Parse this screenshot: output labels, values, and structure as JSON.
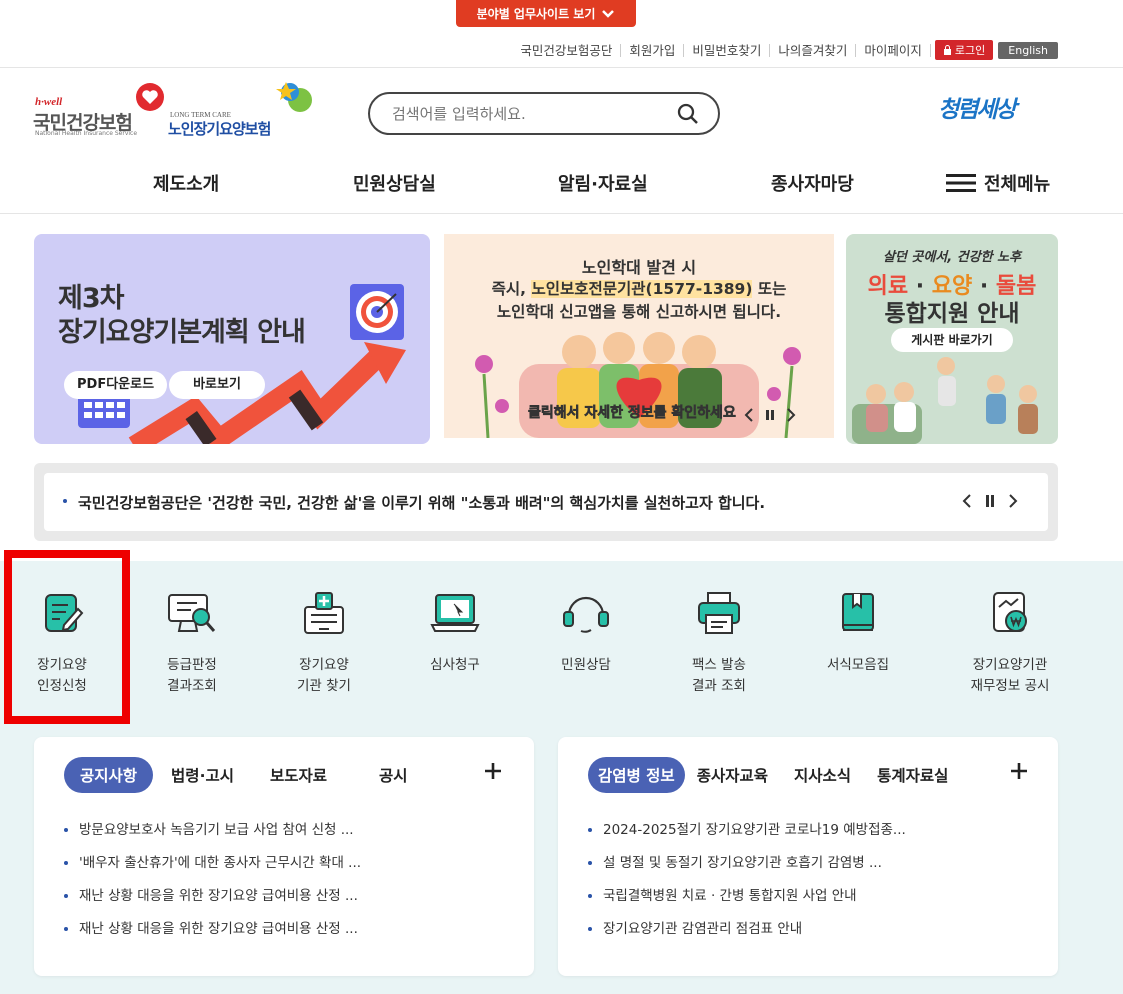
{
  "top_button": "분야별 업무사이트 보기",
  "util_links": [
    "국민건강보험공단",
    "회원가입",
    "비밀번호찾기",
    "나의즐겨찾기",
    "마이페이지"
  ],
  "login_label": "로그인",
  "english_label": "English",
  "logo_nhis": {
    "top": "h·well",
    "main": "국민건강보험",
    "sub": "National Health Insurance Service"
  },
  "logo_ltc": {
    "top": "LONG TERM CARE",
    "main": "노인장기요양보험"
  },
  "search": {
    "placeholder": "검색어를 입력하세요."
  },
  "clean_logo": "청렴세상",
  "gnb": [
    "제도소개",
    "민원상담실",
    "알림·자료실",
    "종사자마당"
  ],
  "all_menu": "전체메뉴",
  "banner1": {
    "line1": "제3차",
    "line2": "장기요양기본계획 안내",
    "btn1": "PDF다운로드",
    "btn2": "바로보기"
  },
  "banner2": {
    "line1": "노인학대 발견 시",
    "line2a": "즉시, ",
    "line2b": "노인보호전문기관(1577-1389)",
    "line2c": " 또는",
    "line3": "노인학대 신고앱을 통해 신고하시면 됩니다.",
    "caption": "클릭해서 자세한 정보를 확인하세요"
  },
  "banner3": {
    "script": "살던 곳에서, 건강한 노후",
    "line1a": "의료",
    "line1b": "요양",
    "line1c": "돌봄",
    "line2": "통합지원 안내",
    "btn": "게시판 바로가기"
  },
  "notice_text": "국민건강보험공단은 '건강한 국민, 건강한 삶'을 이루기 위해 \"소통과 배려\"의 핵심가치를 실천하고자 합니다.",
  "quick_menu": [
    {
      "l1": "장기요양",
      "l2": "인정신청"
    },
    {
      "l1": "등급판정",
      "l2": "결과조회"
    },
    {
      "l1": "장기요양",
      "l2": "기관 찾기"
    },
    {
      "l1": "심사청구",
      "l2": ""
    },
    {
      "l1": "민원상담",
      "l2": ""
    },
    {
      "l1": "팩스 발송",
      "l2": "결과 조회"
    },
    {
      "l1": "서식모음집",
      "l2": ""
    },
    {
      "l1": "장기요양기관",
      "l2": "재무정보 공시"
    }
  ],
  "board1": {
    "tabs": [
      "공지사항",
      "법령·고시",
      "보도자료",
      "공시"
    ],
    "items": [
      "방문요양보호사 녹음기기 보급 사업 참여 신청 ...",
      "'배우자 출산휴가'에 대한 종사자 근무시간 확대 ...",
      "재난 상황 대응을 위한 장기요양 급여비용 산정 ...",
      "재난 상황 대응을 위한 장기요양 급여비용 산정 ..."
    ]
  },
  "board2": {
    "tabs": [
      "감염병 정보",
      "종사자교육",
      "지사소식",
      "통계자료실"
    ],
    "items": [
      "2024-2025절기 장기요양기관 코로나19 예방접종...",
      "설 명절 및 동절기 장기요양기관 호흡기 감염병 ...",
      "국립결핵병원 치료 · 간병 통합지원 사업 안내",
      "장기요양기관 감염관리 점검표 안내"
    ]
  },
  "colors": {
    "accent": "#e03c22",
    "teal": "#27c0a8",
    "navy": "#4a62b4",
    "highlight": "#ee0000"
  }
}
